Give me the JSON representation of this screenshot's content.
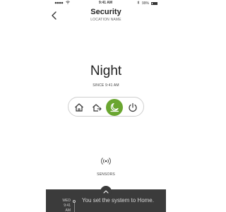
{
  "status_bar": {
    "time": "9:41 AM",
    "battery": "99%",
    "signal_icon": "signal-dots-icon",
    "wifi_icon": "wifi-icon",
    "bluetooth_icon": "bluetooth-icon"
  },
  "header": {
    "title": "Security",
    "subtitle": "LOCATION NAME"
  },
  "mode": {
    "name": "Night",
    "since": "SINCE 9:41 AM",
    "options": [
      {
        "id": "home",
        "icon": "home-icon",
        "active": false
      },
      {
        "id": "away",
        "icon": "away-icon",
        "active": false
      },
      {
        "id": "night",
        "icon": "night-icon",
        "active": true
      },
      {
        "id": "off",
        "icon": "power-icon",
        "active": false
      }
    ]
  },
  "sensors": {
    "label": "SENSORS",
    "icon": "sensors-icon"
  },
  "activity": {
    "day": "WED",
    "time": "9:41 AM",
    "message": "You set the system to Home."
  },
  "colors": {
    "accent": "#6aa630",
    "panel": "#3b3b3b",
    "text": "#222222"
  }
}
